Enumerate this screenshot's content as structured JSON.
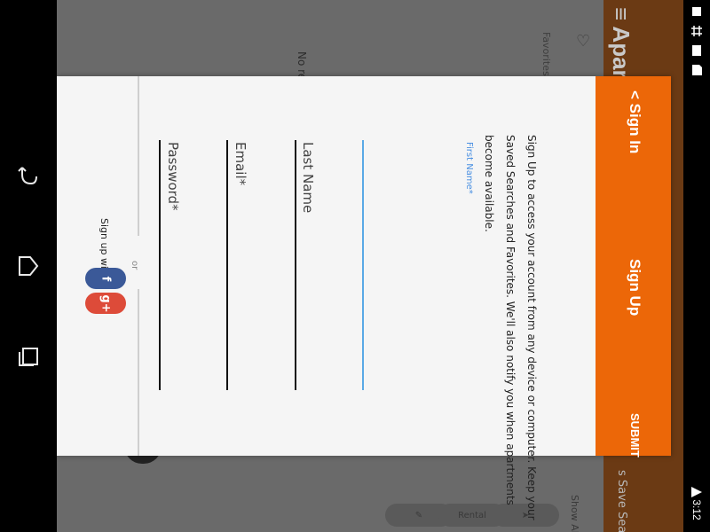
{
  "status": {
    "time": "3:12"
  },
  "navigation": {
    "back_icon": "back-arrow-icon",
    "home_icon": "home-icon",
    "recents_icon": "recents-icon"
  },
  "background": {
    "title": "≡ Apartme",
    "favorites_label": "Favorites",
    "no_results": "No resu",
    "save_search": "s   Save Search",
    "show_all": "Show All",
    "pill_label": "Rental"
  },
  "dialog": {
    "header": {
      "back_label": "< Sign In",
      "title": "Sign Up",
      "submit": "SUBMIT"
    },
    "intro_lines": [
      "Sign Up to access your account from any device or computer. Keep your",
      "Saved Searches and Favorites. We'll also notify you when apartments",
      "become available."
    ],
    "fields": {
      "first_name_label": "First Name*",
      "last_name_label": "Last Name",
      "email_label": "Email*",
      "password_label": "Password*"
    },
    "or_label": "or",
    "sign_up_with": "Sign up with",
    "facebook_glyph": "f",
    "google_glyph": "g+"
  },
  "colors": {
    "accent": "#ec6708",
    "facebook": "#3b5998",
    "google": "#dd4b39",
    "input_active": "#5aa9e6"
  }
}
